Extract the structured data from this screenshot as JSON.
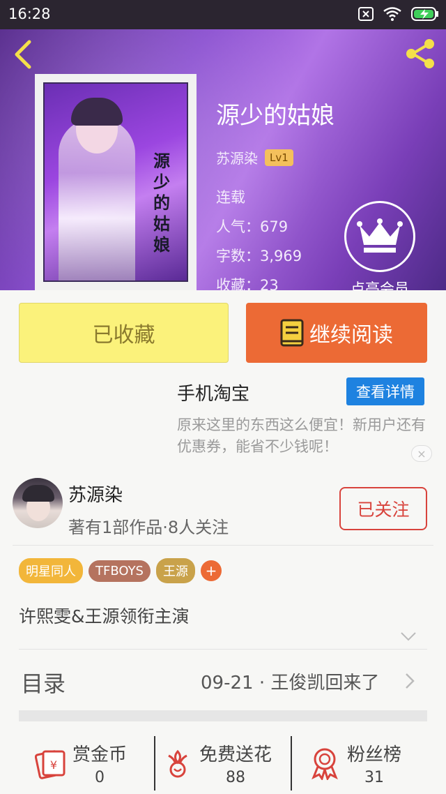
{
  "status_bar": {
    "time": "16:28"
  },
  "book": {
    "title": "源少的姑娘",
    "author": "苏源染",
    "level": "Lv1",
    "status": "连载",
    "popularity": "人气：679",
    "word_count": "字数：3,969",
    "favorites": "收藏：23",
    "cover_text": "源少的姑娘"
  },
  "vip": {
    "label": "点亮会员"
  },
  "actions": {
    "collect_label": "已收藏",
    "read_label": "继续阅读"
  },
  "ad": {
    "title": "手机淘宝",
    "button_label": "查看详情",
    "description": "原来这里的东西这么便宜！新用户还有优惠券，能省不少钱呢！",
    "close_label": "×"
  },
  "author_card": {
    "name": "苏源染",
    "stats": "著有1部作品·8人关注",
    "follow_label": "已关注"
  },
  "tags": [
    {
      "label": "明星同人",
      "color": "#f2b63a"
    },
    {
      "label": "TFBOYS",
      "color": "#b5735f"
    },
    {
      "label": "王源",
      "color": "#c9a24a"
    }
  ],
  "tag_add_label": "+",
  "intro": "许熙雯&王源领衔主演",
  "catalog": {
    "label": "目录",
    "latest": "09-21 · 王俊凯回来了"
  },
  "bottom_bar": [
    {
      "label": "赏金币",
      "count": "0",
      "icon": "red-packet-icon"
    },
    {
      "label": "免费送花",
      "count": "88",
      "icon": "flower-icon"
    },
    {
      "label": "粉丝榜",
      "count": "31",
      "icon": "medal-icon"
    }
  ],
  "colors": {
    "accent": "#ec6a35",
    "collect": "#fbf27b",
    "follow": "#d8433c",
    "ad_button": "#1e82e0"
  }
}
